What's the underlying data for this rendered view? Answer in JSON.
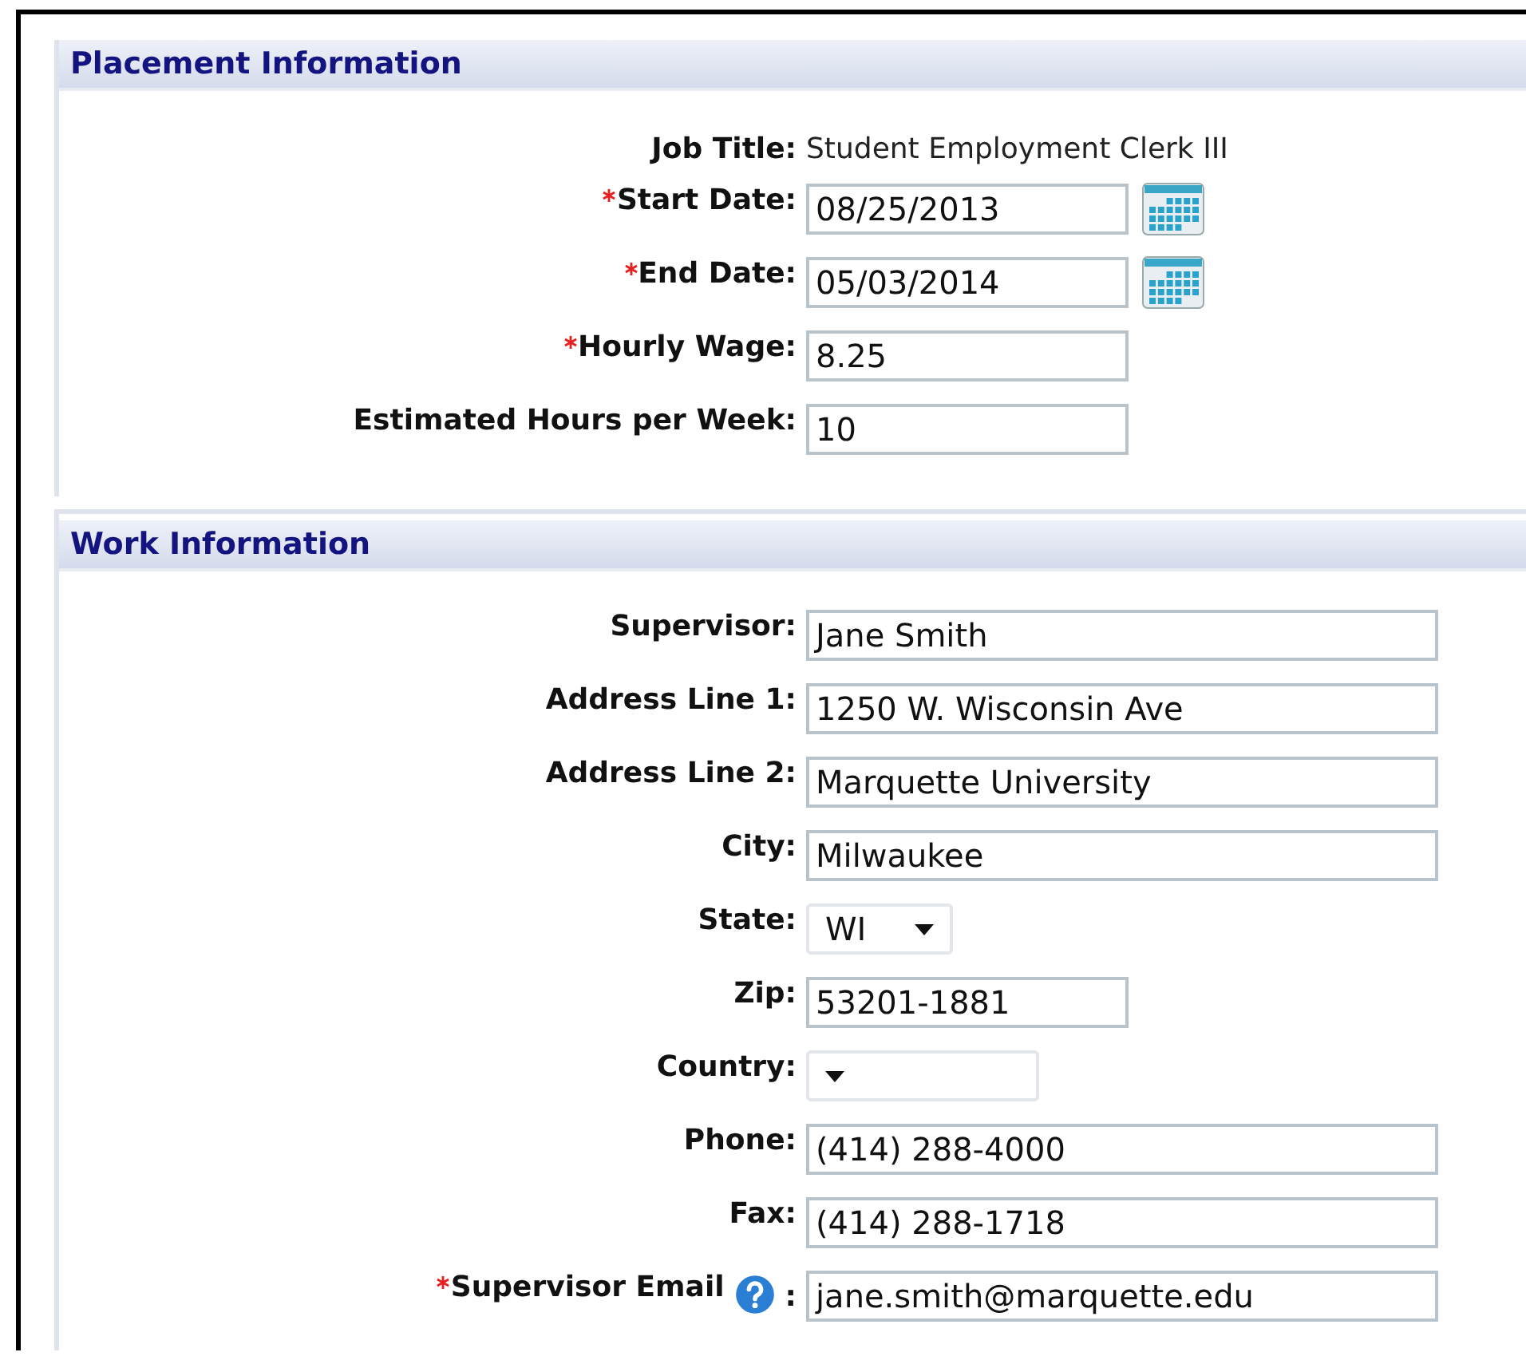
{
  "sections": [
    {
      "title": "Placement Information",
      "fields": [
        {
          "label": "Job Title:",
          "required": false,
          "kind": "static",
          "value": "Student Employment Clerk III"
        },
        {
          "label": "Start Date:",
          "required": true,
          "kind": "date",
          "value": "08/25/2013"
        },
        {
          "label": "End Date:",
          "required": true,
          "kind": "date",
          "value": "05/03/2014"
        },
        {
          "label": "Hourly Wage:",
          "required": true,
          "kind": "short",
          "value": "8.25"
        },
        {
          "label": "Estimated Hours per Week:",
          "required": false,
          "kind": "short",
          "value": "10"
        }
      ]
    },
    {
      "title": "Work Information",
      "fields": [
        {
          "label": "Supervisor:",
          "required": false,
          "kind": "long",
          "value": "Jane Smith"
        },
        {
          "label": "Address Line 1:",
          "required": false,
          "kind": "long",
          "value": "1250 W. Wisconsin Ave"
        },
        {
          "label": "Address Line 2:",
          "required": false,
          "kind": "long",
          "value": "Marquette University"
        },
        {
          "label": "City:",
          "required": false,
          "kind": "long",
          "value": "Milwaukee"
        },
        {
          "label": "State:",
          "required": false,
          "kind": "select-narrow",
          "value": "WI"
        },
        {
          "label": "Zip:",
          "required": false,
          "kind": "short",
          "value": "53201-1881"
        },
        {
          "label": "Country:",
          "required": false,
          "kind": "select-wide"
        },
        {
          "label": "Phone:",
          "required": false,
          "kind": "long",
          "value": "(414) 288-4000"
        },
        {
          "label": "Fax:",
          "required": false,
          "kind": "long",
          "value": "(414) 288-1718"
        },
        {
          "label": "Supervisor Email",
          "required": true,
          "kind": "help-long",
          "suffix": ":",
          "value": "jane.smith@marquette.edu"
        }
      ]
    }
  ]
}
